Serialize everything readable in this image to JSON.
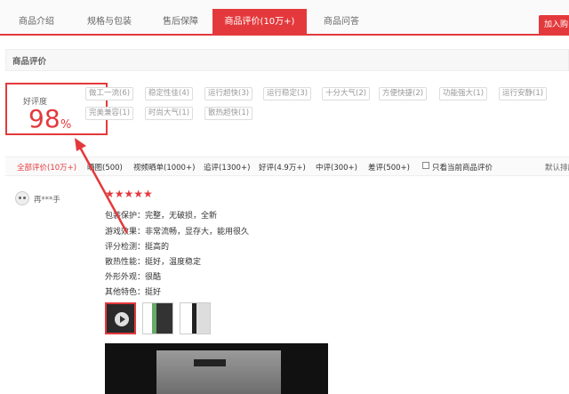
{
  "tabs": [
    {
      "label": "商品介绍"
    },
    {
      "label": "规格与包装"
    },
    {
      "label": "售后保障"
    },
    {
      "label": "商品评价(10万+)"
    },
    {
      "label": "商品问答"
    }
  ],
  "cart_button": "加入购",
  "section_title": "商品评价",
  "rating": {
    "label": "好评度",
    "value": "98",
    "unit": "%"
  },
  "tags": [
    "做工一流(6)",
    "稳定性佳(4)",
    "运行超快(3)",
    "运行稳定(3)",
    "十分大气(2)",
    "方便快捷(2)",
    "功能强大(1)",
    "运行安静(1)",
    "完美兼容(1)",
    "时尚大气(1)",
    "散热超快(1)"
  ],
  "filters": [
    "全部评价(10万+)",
    "晒图(500)",
    "视频晒单(1000+)",
    "追评(1300+)",
    "好评(4.9万+)",
    "中评(300+)",
    "差评(500+)"
  ],
  "filter_checkbox_label": "只看当前商品评价",
  "sort_label": "默认排序",
  "review": {
    "username": "再***手",
    "stars": "★★★★★",
    "lines": [
      "包装保护：完整，无破损，全新",
      "游戏效果：非常流畅，显存大，能用很久",
      "评分检测：挺高的",
      "散热性能：挺好，温度稳定",
      "外形外观：很酷",
      "其他特色：挺好"
    ]
  },
  "colors": {
    "accent": "#e4393c"
  }
}
